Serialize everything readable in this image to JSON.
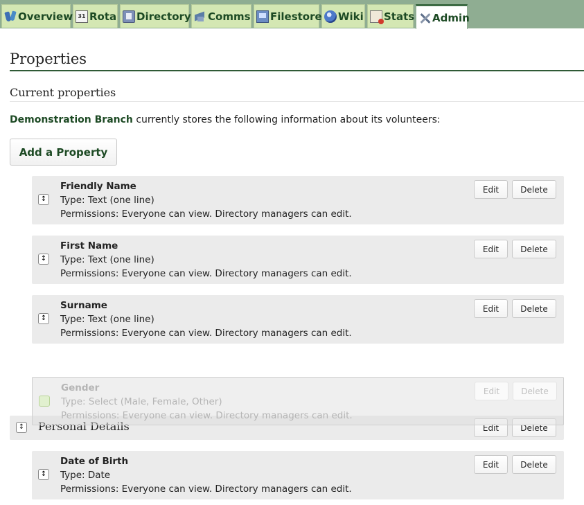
{
  "nav": {
    "tabs": [
      {
        "label": "Overview",
        "icon": "overview-icon"
      },
      {
        "label": "Rota",
        "icon": "calendar-icon",
        "icon_text": "31"
      },
      {
        "label": "Directory",
        "icon": "directory-icon"
      },
      {
        "label": "Comms",
        "icon": "comms-icon"
      },
      {
        "label": "Filestore",
        "icon": "filestore-icon"
      },
      {
        "label": "Wiki",
        "icon": "wiki-icon"
      },
      {
        "label": "Stats",
        "icon": "stats-icon"
      },
      {
        "label": "Admin",
        "icon": "admin-tools-icon",
        "active": true
      }
    ]
  },
  "page": {
    "title": "Properties",
    "section_title": "Current properties",
    "intro_org": "Demonstration Branch",
    "intro_text": " currently stores the following information about its volunteers:",
    "add_button": "Add a Property",
    "handle_glyph": "↕"
  },
  "buttons": {
    "edit": "Edit",
    "delete": "Delete"
  },
  "properties": [
    {
      "name": "Friendly Name",
      "type": "Type: Text (one line)",
      "permissions": "Permissions: Everyone can view. Directory managers can edit."
    },
    {
      "name": "First Name",
      "type": "Type: Text (one line)",
      "permissions": "Permissions: Everyone can view. Directory managers can edit."
    },
    {
      "name": "Surname",
      "type": "Type: Text (one line)",
      "permissions": "Permissions: Everyone can view. Directory managers can edit."
    },
    {
      "name": "Gender",
      "type": "Type: Select (Male, Female, Other)",
      "permissions": "Permissions: Everyone can view. Directory managers can edit.",
      "dragging": true
    },
    {
      "name": "Date of Birth",
      "type": "Type: Date",
      "permissions": "Permissions: Everyone can view. Directory managers can edit."
    }
  ],
  "group": {
    "name": "Personal Details"
  },
  "colors": {
    "nav_bg": "#8fad92",
    "tab_bg": "#d4e7b3",
    "accent": "#1d4a24",
    "row_bg": "#ebebeb"
  }
}
